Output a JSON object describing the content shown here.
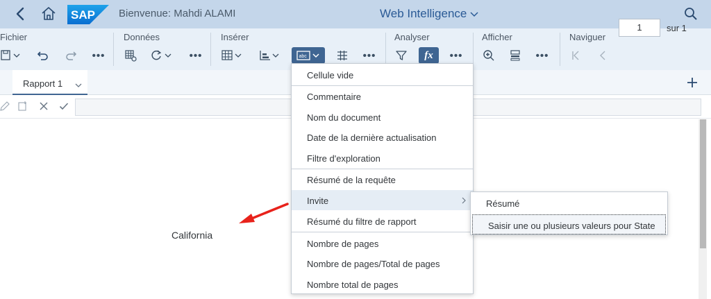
{
  "shell": {
    "welcome": "Bienvenue: Mahdi ALAMI",
    "app_title": "Web Intelligence",
    "logo_text": "SAP"
  },
  "toolbar": {
    "groups": {
      "fichier": "Fichier",
      "donnees": "Données",
      "inserer": "Insérer",
      "analyser": "Analyser",
      "afficher": "Afficher",
      "naviguer": "Naviguer"
    },
    "more": "•••",
    "formula_label": "fx",
    "page_value": "1",
    "page_of": "sur 1"
  },
  "tabs": {
    "report1": "Rapport 1"
  },
  "report": {
    "cell_text": "California"
  },
  "menu": {
    "items": [
      "Cellule vide",
      "Commentaire",
      "Nom du document",
      "Date de la dernière actualisation",
      "Filtre d'exploration",
      "Résumé de la requête",
      "Invite",
      "Résumé du filtre de rapport",
      "Nombre de pages",
      "Nombre de pages/Total de pages",
      "Nombre total de pages"
    ]
  },
  "submenu": {
    "items": [
      "Résumé",
      "Saisir une ou plusieurs valeurs pour State"
    ]
  },
  "colors": {
    "shell_bg": "#c4d6ea",
    "toolbar_bg": "#e8f0f8",
    "accent": "#3f6592",
    "annotation_arrow": "#e8221b"
  }
}
